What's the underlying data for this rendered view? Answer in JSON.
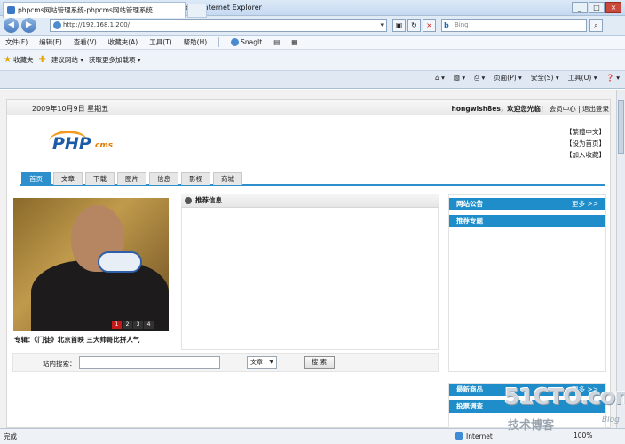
{
  "window": {
    "title": "phpcms网站管理系统-phpcms网站管理系统 - Windows Internet Explorer",
    "controls": [
      "_",
      "□",
      "×"
    ]
  },
  "address_bar": {
    "url": "http://192.168.1.200/",
    "search_placeholder": "Bing"
  },
  "menu": [
    "文件(F)",
    "编辑(E)",
    "查看(V)",
    "收藏夹(A)",
    "工具(T)",
    "帮助(H)"
  ],
  "snagit": "SnagIt",
  "favorites_bar": {
    "favorites": "收藏夹",
    "suggested": "建议网站 ▾",
    "more_addons": "获取更多加载项 ▾"
  },
  "tab": {
    "title": "phpcms网站管理系统-phpcms网站管理系统"
  },
  "command_bar": {
    "page": "页面(P) ▾",
    "safety": "安全(S) ▾",
    "tools": "工具(O) ▾",
    "help": "❓ ▾"
  },
  "site": {
    "date": "2009年10月9日  星期五",
    "user_greeting": "hongwish8es，欢迎您光临！",
    "member_center": "会员中心",
    "logout": "退出登录",
    "logo_text": "PHP",
    "logo_sub": "cms",
    "right_links": [
      "【繁體中文】",
      "【设为首页】",
      "【加入收藏】"
    ],
    "nav": [
      "首页",
      "文章",
      "下载",
      "图片",
      "信息",
      "影视",
      "商城"
    ],
    "photo_pager": [
      "1",
      "2",
      "3",
      "4"
    ],
    "photo_caption": "专辑：《门徒》北京首映 三大帅哥比拼人气",
    "recommended_heading": "推荐信息",
    "search_label": "站内搜索：",
    "search_type": "文章",
    "search_button": "搜 索",
    "notice_heading": "网站公告",
    "more_link": "更多 >>",
    "special_heading": "推荐专题",
    "new_products_heading": "最新商品",
    "vote_heading": "投票调查"
  },
  "status_bar": {
    "done": "完成",
    "zone": "Internet",
    "zoom": "100%"
  },
  "watermark": {
    "main": "51CTO.com",
    "sub": "技术博客",
    "blog": "Blog"
  }
}
